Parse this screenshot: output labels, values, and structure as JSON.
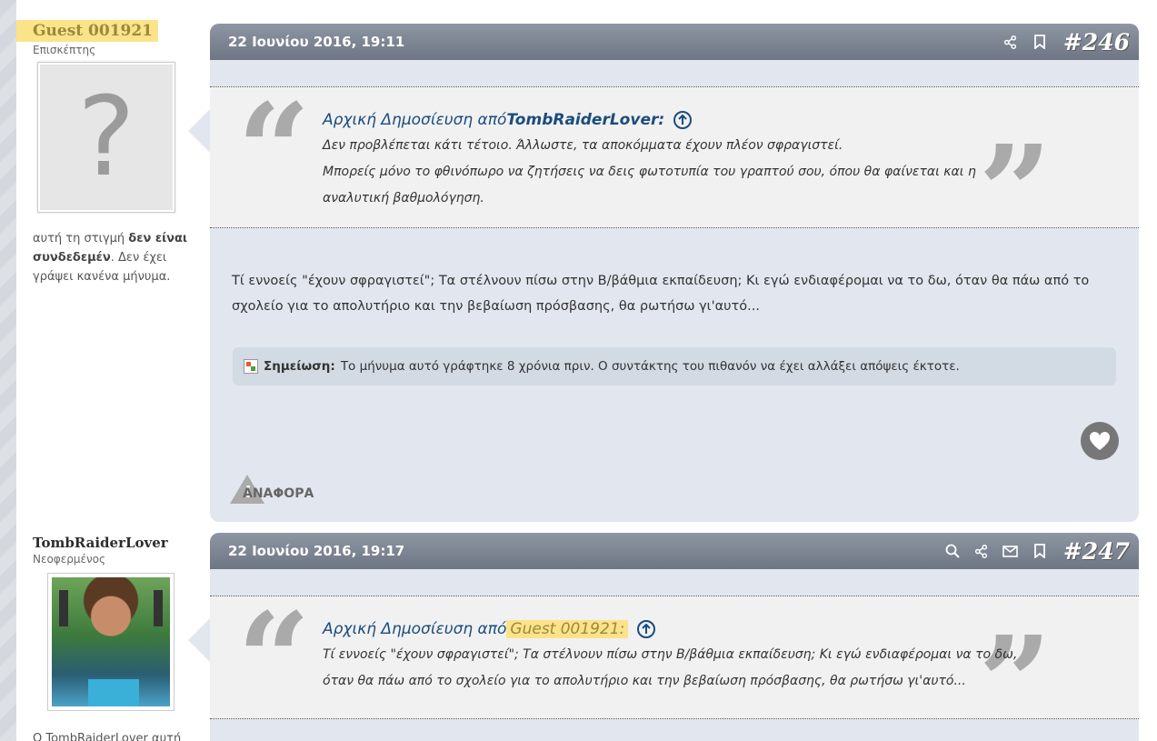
{
  "posts": [
    {
      "user": {
        "name": "Guest 001921",
        "title": "Επισκέπτης",
        "status_prefix": "αυτή τη στιγμή ",
        "status_bold": "δεν είναι συνδεδεμέν",
        "status_suffix": ". Δεν έχει γράψει κανένα μήνυμα."
      },
      "date": "22 Ιουνίου 2016, 19:11",
      "number": "#246",
      "quote": {
        "prefix": "Αρχική Δημοσίευση από ",
        "author": "TombRaiderLover:",
        "lines": [
          "Δεν προβλέπεται κάτι τέτοιο. Άλλωστε, τα αποκόμματα έχουν πλέον σφραγιστεί.",
          "Μπορείς μόνο το φθινόπωρο να ζητήσεις να δεις φωτοτυπία του γραπτού σου, όπου θα φαίνεται και η αναλυτική βαθμολόγηση."
        ]
      },
      "body": "Τί εννοείς \"έχουν σφραγιστεί\"; Τα στέλνουν πίσω στην Β/βάθμια εκπαίδευση; Κι εγώ ενδιαφέρομαι να το δω, όταν θα πάω από το σχολείο για το απολυτήριο και την βεβαίωση πρόσβασης, θα ρωτήσω γι'αυτό...",
      "note_label": "Σημείωση:",
      "note_text": "Το μήνυμα αυτό γράφτηκε 8 χρόνια πριν. Ο συντάκτης του πιθανόν να έχει αλλάξει απόψεις έκτοτε.",
      "report_label": "ΑΝΑΦΟΡΑ"
    },
    {
      "user": {
        "name": "TombRaiderLover",
        "title": "Νεοφερμένος",
        "status_prefix": "Ο TombRaiderLover αυτή"
      },
      "date": "22 Ιουνίου 2016, 19:17",
      "number": "#247",
      "quote": {
        "prefix": "Αρχική Δημοσίευση από",
        "author": "Guest 001921:",
        "lines": [
          "Τί εννοείς \"έχουν σφραγιστεί\"; Τα στέλνουν πίσω στην Β/βάθμια εκπαίδευση; Κι εγώ ενδιαφέρομαι να το δω, όταν θα πάω από το σχολείο για το απολυτήριο και την βεβαίωση πρόσβασης, θα ρωτήσω γι'αυτό..."
        ]
      }
    }
  ],
  "icons": {
    "share": "share-icon",
    "bookmark": "bookmark-icon",
    "search": "search-icon",
    "mail": "mail-icon",
    "like": "heart-icon",
    "report": "warning-icon",
    "quote_up": "arrow-up-circle-icon"
  },
  "colors": {
    "header_gradient_top": "#8e96a3",
    "header_gradient_bottom": "#6e7684",
    "highlight": "#fbe38a",
    "quote_author": "#1b4c7d"
  }
}
